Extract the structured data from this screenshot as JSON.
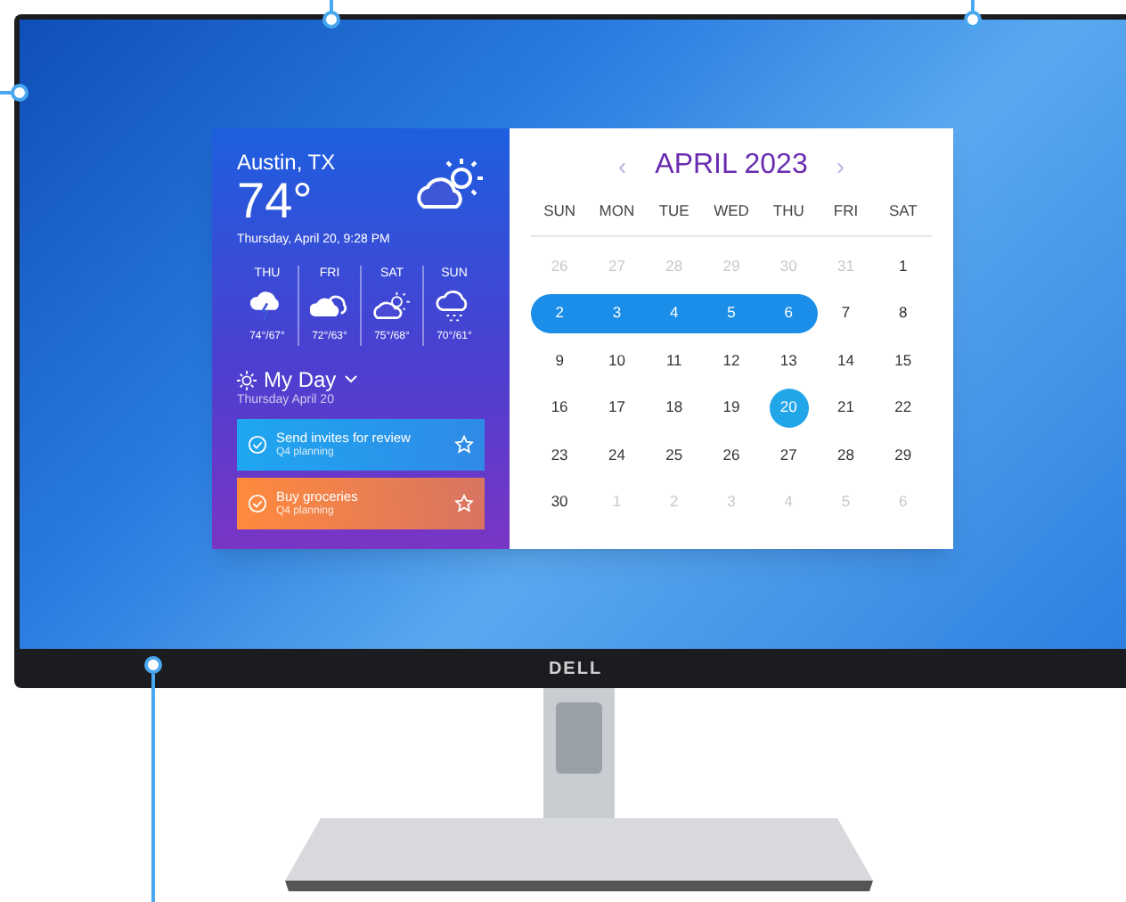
{
  "weather": {
    "city": "Austin, TX",
    "temperature": "74°",
    "datetime": "Thursday, April 20, 9:28 PM",
    "forecast": [
      {
        "day": "THU",
        "temps": "74°/67°",
        "kind": "storm"
      },
      {
        "day": "FRI",
        "temps": "72°/63°",
        "kind": "cloudy"
      },
      {
        "day": "SAT",
        "temps": "75°/68°",
        "kind": "partly-sunny"
      },
      {
        "day": "SUN",
        "temps": "70°/61°",
        "kind": "rain"
      }
    ]
  },
  "my_day": {
    "title": "My Day",
    "date": "Thursday April 20",
    "tasks": [
      {
        "title": "Send invites for review",
        "subtitle": "Q4 planning",
        "color": "#1ea7f0"
      },
      {
        "title": "Buy groceries",
        "subtitle": "Q4 planning",
        "color": "#ff8a3d"
      }
    ]
  },
  "calendar": {
    "prev": "‹",
    "title": "APRIL 2023",
    "next": "›",
    "weekdays": [
      "SUN",
      "MON",
      "TUE",
      "WED",
      "THU",
      "FRI",
      "SAT"
    ],
    "weeks": [
      [
        {
          "d": "26",
          "outside": true,
          "in_range": false,
          "selected": false
        },
        {
          "d": "27",
          "outside": true,
          "in_range": false,
          "selected": false
        },
        {
          "d": "28",
          "outside": true,
          "in_range": false,
          "selected": false
        },
        {
          "d": "29",
          "outside": true,
          "in_range": false,
          "selected": false
        },
        {
          "d": "30",
          "outside": true,
          "in_range": false,
          "selected": false
        },
        {
          "d": "31",
          "outside": true,
          "in_range": false,
          "selected": false
        },
        {
          "d": "1",
          "outside": false,
          "in_range": false,
          "selected": false
        }
      ],
      [
        {
          "d": "2",
          "outside": false,
          "in_range": true,
          "selected": false
        },
        {
          "d": "3",
          "outside": false,
          "in_range": true,
          "selected": false
        },
        {
          "d": "4",
          "outside": false,
          "in_range": true,
          "selected": false
        },
        {
          "d": "5",
          "outside": false,
          "in_range": true,
          "selected": false
        },
        {
          "d": "6",
          "outside": false,
          "in_range": true,
          "selected": false
        },
        {
          "d": "7",
          "outside": false,
          "in_range": false,
          "selected": false
        },
        {
          "d": "8",
          "outside": false,
          "in_range": false,
          "selected": false
        }
      ],
      [
        {
          "d": "9",
          "outside": false,
          "in_range": false,
          "selected": false
        },
        {
          "d": "10",
          "outside": false,
          "in_range": false,
          "selected": false
        },
        {
          "d": "11",
          "outside": false,
          "in_range": false,
          "selected": false
        },
        {
          "d": "12",
          "outside": false,
          "in_range": false,
          "selected": false
        },
        {
          "d": "13",
          "outside": false,
          "in_range": false,
          "selected": false
        },
        {
          "d": "14",
          "outside": false,
          "in_range": false,
          "selected": false
        },
        {
          "d": "15",
          "outside": false,
          "in_range": false,
          "selected": false
        }
      ],
      [
        {
          "d": "16",
          "outside": false,
          "in_range": false,
          "selected": false
        },
        {
          "d": "17",
          "outside": false,
          "in_range": false,
          "selected": false
        },
        {
          "d": "18",
          "outside": false,
          "in_range": false,
          "selected": false
        },
        {
          "d": "19",
          "outside": false,
          "in_range": false,
          "selected": false
        },
        {
          "d": "20",
          "outside": false,
          "in_range": false,
          "selected": true
        },
        {
          "d": "21",
          "outside": false,
          "in_range": false,
          "selected": false
        },
        {
          "d": "22",
          "outside": false,
          "in_range": false,
          "selected": false
        }
      ],
      [
        {
          "d": "23",
          "outside": false,
          "in_range": false,
          "selected": false
        },
        {
          "d": "24",
          "outside": false,
          "in_range": false,
          "selected": false
        },
        {
          "d": "25",
          "outside": false,
          "in_range": false,
          "selected": false
        },
        {
          "d": "26",
          "outside": false,
          "in_range": false,
          "selected": false
        },
        {
          "d": "27",
          "outside": false,
          "in_range": false,
          "selected": false
        },
        {
          "d": "28",
          "outside": false,
          "in_range": false,
          "selected": false
        },
        {
          "d": "29",
          "outside": false,
          "in_range": false,
          "selected": false
        }
      ],
      [
        {
          "d": "30",
          "outside": false,
          "in_range": false,
          "selected": false
        },
        {
          "d": "1",
          "outside": true,
          "in_range": false,
          "selected": false
        },
        {
          "d": "2",
          "outside": true,
          "in_range": false,
          "selected": false
        },
        {
          "d": "3",
          "outside": true,
          "in_range": false,
          "selected": false
        },
        {
          "d": "4",
          "outside": true,
          "in_range": false,
          "selected": false
        },
        {
          "d": "5",
          "outside": true,
          "in_range": false,
          "selected": false
        },
        {
          "d": "6",
          "outside": true,
          "in_range": false,
          "selected": false
        }
      ]
    ]
  },
  "monitor": {
    "logo": "DELL"
  }
}
